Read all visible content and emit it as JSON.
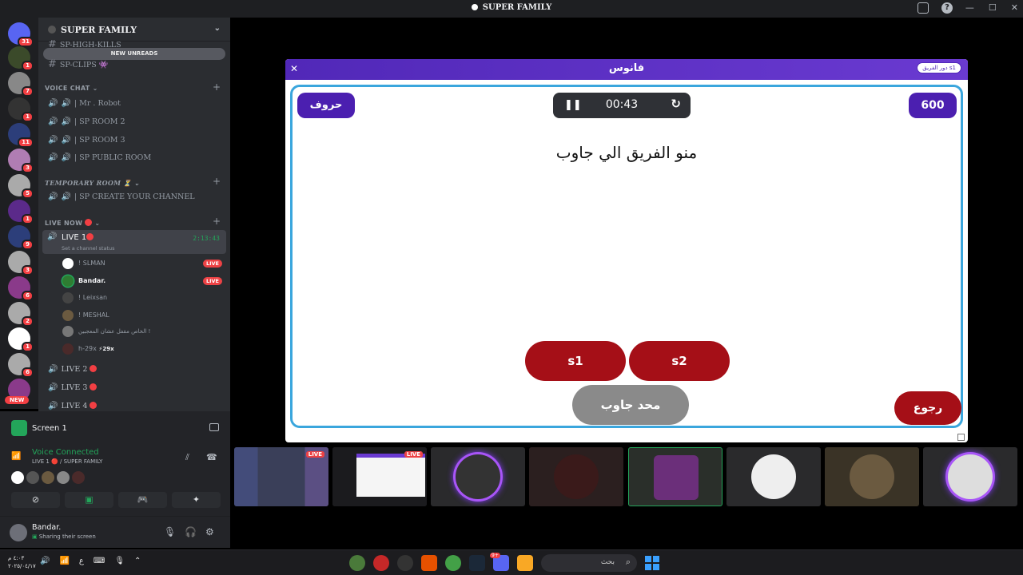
{
  "window": {
    "title": "SUPER FAMILY"
  },
  "guilds": [
    {
      "badge": "31"
    },
    {
      "badge": "1"
    },
    {
      "badge": "7"
    },
    {
      "badge": "1"
    },
    {
      "badge": "11"
    },
    {
      "badge": "3"
    },
    {
      "badge": "5"
    },
    {
      "badge": "1"
    },
    {
      "badge": "9"
    },
    {
      "badge": "3"
    },
    {
      "badge": "6"
    },
    {
      "badge": "2"
    },
    {
      "badge": "1"
    },
    {
      "badge": "6"
    }
  ],
  "guild_new": "NEW",
  "server": {
    "name": "SUPER FAMILY",
    "new_unreads": "NEW UNREADS",
    "channel_cut": "SP-HIGH-KILLS",
    "channel_clips": "SP-CLIPS 👾",
    "cat_voice": "VOICE CHAT ⌄",
    "voice": [
      "| Mr . Robot",
      "| SP ROOM 2",
      "| SP ROOM 3",
      "| SP PUBLIC ROOM"
    ],
    "cat_temp": "TEMPORARY ROOM ⏳ ⌄",
    "temp": [
      "| SP CREATE YOUR CHANNEL"
    ],
    "cat_live": "LIVE NOW",
    "live1": {
      "name": "LIVE 1",
      "time": "2:13:43",
      "status": "Set a channel status"
    },
    "live_users": [
      {
        "name": "! SLMAN",
        "live": "LIVE"
      },
      {
        "name": "Bandar.",
        "live": "LIVE"
      },
      {
        "name": "! Leixsan",
        "live": ""
      },
      {
        "name": "! MESHAL",
        "live": ""
      },
      {
        "name": "الخاص مقفل عشان المعجبين !",
        "live": ""
      },
      {
        "name": "h-29x",
        "live": ""
      }
    ],
    "tag_29x": "29x",
    "lives": [
      "LIVE 2",
      "LIVE 3",
      "LIVE 4"
    ]
  },
  "panel": {
    "screen_title": "Screen 1",
    "vc_title": "Voice Connected",
    "vc_sub": "LIVE 1 🔴 / SUPER FAMILY",
    "user_name": "Bandar.",
    "user_sub": "Sharing their screen"
  },
  "game": {
    "app_name": "فانوس",
    "turn": "دور الفريق s1",
    "letters_btn": "حروف",
    "score": "600",
    "time": "00:43",
    "question": "منو الفريق الي جاوب",
    "team_a": "s1",
    "team_b": "s2",
    "no_one": "محد جاوب",
    "back": "رجوع"
  },
  "thumbs": {
    "live": "LIVE"
  },
  "taskbar": {
    "time": "٤:٠٣ م",
    "date": "٢٠٢٥/٠٤/١٧",
    "lang": "ع",
    "search": "بحث",
    "discord_badge": "9+"
  },
  "colors": {
    "accent": "#4b1fb0",
    "team": "#a50f17",
    "online": "#23a55a",
    "live": "#ed4245"
  }
}
